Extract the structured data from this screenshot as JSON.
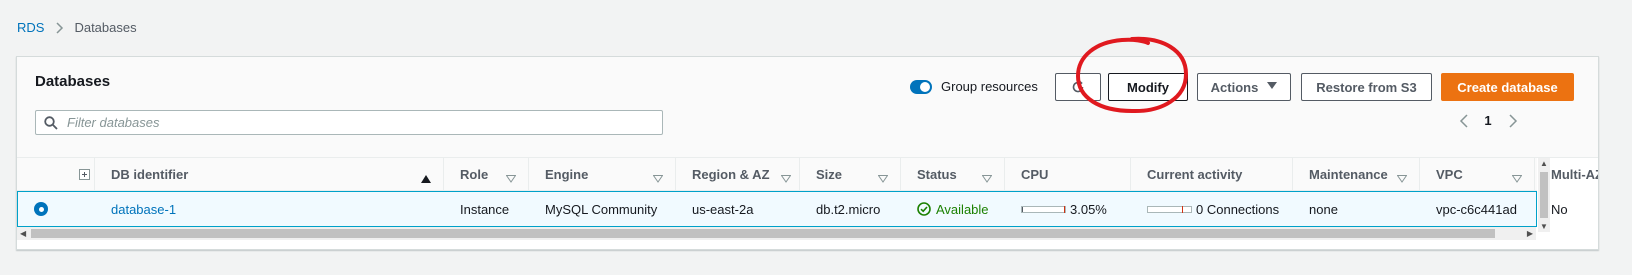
{
  "breadcrumb": {
    "root": "RDS",
    "current": "Databases"
  },
  "panel": {
    "title": "Databases",
    "group_resources_label": "Group resources",
    "group_resources_enabled": true,
    "buttons": {
      "modify": "Modify",
      "actions": "Actions",
      "restore": "Restore from S3",
      "create": "Create database"
    },
    "search": {
      "placeholder": "Filter databases",
      "value": ""
    },
    "pager": {
      "page": "1"
    }
  },
  "table": {
    "columns": {
      "db_identifier": "DB identifier",
      "role": "Role",
      "engine": "Engine",
      "region": "Region & AZ",
      "size": "Size",
      "status": "Status",
      "cpu": "CPU",
      "activity": "Current activity",
      "maintenance": "Maintenance",
      "vpc": "VPC",
      "multi_az": "Multi-AZ"
    },
    "rows": [
      {
        "selected": true,
        "db_identifier": "database-1",
        "role": "Instance",
        "engine": "MySQL Community",
        "region": "us-east-2a",
        "size": "db.t2.micro",
        "status": "Available",
        "cpu": "3.05%",
        "cpu_fraction": 0.0305,
        "activity": "0 Connections",
        "maintenance": "none",
        "vpc": "vpc-c6c441ad",
        "multi_az": "No"
      }
    ]
  },
  "colors": {
    "link": "#0073bb",
    "primary": "#ec7211",
    "success": "#1d8102",
    "annotation": "#e0191f"
  },
  "icons": [
    "chevron-right-icon",
    "refresh-icon",
    "caret-down-icon",
    "search-icon",
    "chevron-left-icon",
    "gear-icon",
    "expand-icon",
    "sort-asc-icon",
    "sort-desc-icon",
    "check-circle-icon"
  ]
}
